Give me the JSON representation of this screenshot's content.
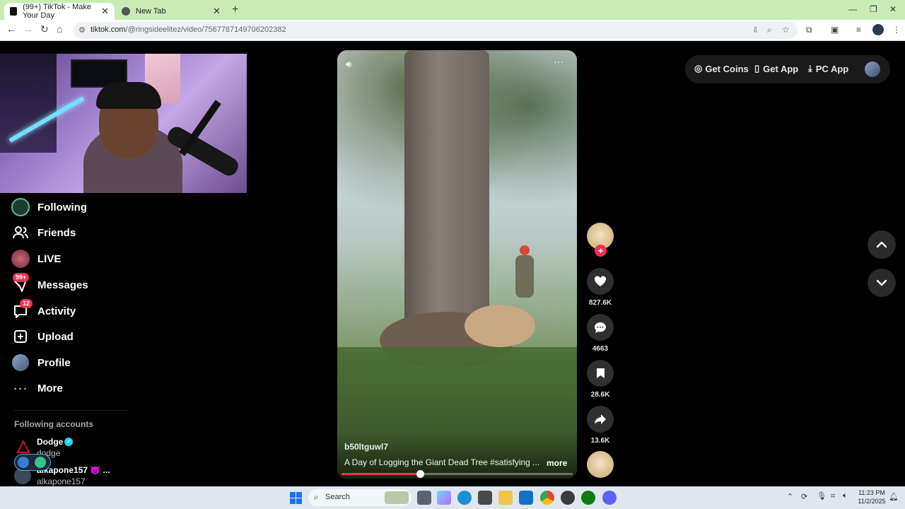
{
  "browser": {
    "tabs": [
      {
        "title": "(99+) TikTok - Make Your Day",
        "active": true
      },
      {
        "title": "New Tab",
        "active": false
      }
    ],
    "url_host": "tiktok.com",
    "url_path": "/@ringsideelitez/video/7567787149706202382"
  },
  "sidebar": {
    "items": [
      {
        "label": "Following",
        "icon": "following-icon"
      },
      {
        "label": "Friends",
        "icon": "friends-icon"
      },
      {
        "label": "LIVE",
        "icon": "live-icon"
      },
      {
        "label": "Messages",
        "icon": "messages-icon",
        "badge": "99+"
      },
      {
        "label": "Activity",
        "icon": "activity-icon",
        "badge": "12"
      },
      {
        "label": "Upload",
        "icon": "upload-icon"
      },
      {
        "label": "Profile",
        "icon": "profile-icon"
      },
      {
        "label": "More",
        "icon": "more-icon"
      }
    ],
    "following_title": "Following accounts",
    "accounts": [
      {
        "name": "Dodge",
        "handle": "dodge",
        "verified": true
      },
      {
        "name": "alkapone157 👿 ...",
        "handle": "alkapone157"
      }
    ]
  },
  "topbar": {
    "get_coins": "Get Coins",
    "get_app": "Get App",
    "pc_app": "PC App"
  },
  "video": {
    "author": "b50ltguwl7",
    "caption": "A Day of Logging the Giant Dead Tree #satisfying ...",
    "more": "more",
    "progress": 0.34
  },
  "actions": {
    "likes": "827.6K",
    "comments": "4663",
    "saves": "28.6K",
    "shares": "13.6K"
  },
  "taskbar": {
    "search": "Search",
    "time": "11:23 PM",
    "date": "11/2/2025"
  },
  "colors": {
    "accent": "#fe2c55",
    "tabbar": "#c9ecb4",
    "verified": "#20d5ec"
  }
}
